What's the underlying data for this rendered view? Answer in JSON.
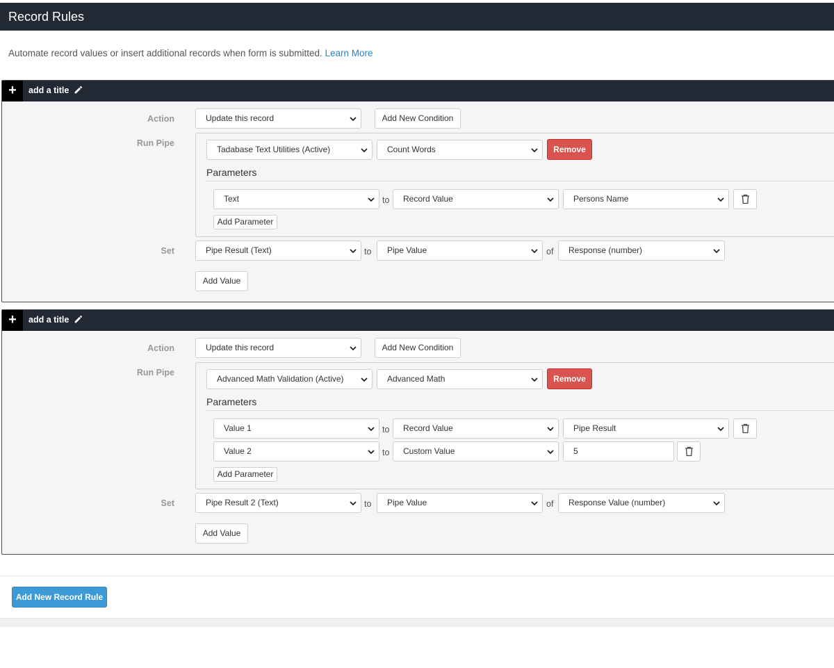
{
  "header": {
    "title": "Record Rules"
  },
  "description": {
    "text": "Automate record values or insert additional records when form is submitted.",
    "link": "Learn More"
  },
  "labels": {
    "action": "Action",
    "run_pipe": "Run Pipe",
    "set": "Set",
    "parameters": "Parameters",
    "to": "to",
    "of": "of"
  },
  "buttons": {
    "add_new_condition": "Add New Condition",
    "remove": "Remove",
    "add_parameter": "Add Parameter",
    "add_value": "Add Value",
    "add_new_record_rule": "Add New Record Rule"
  },
  "rules": [
    {
      "title": "add a title",
      "action": "Update this record",
      "pipe": "Tadabase Text Utilities (Active)",
      "pipe_function": "Count Words",
      "parameters": [
        {
          "name": "Text",
          "source": "Record Value",
          "value": "Persons Name"
        }
      ],
      "set": {
        "field": "Pipe Result (Text)",
        "source": "Pipe Value",
        "target": "Response (number)"
      }
    },
    {
      "title": "add a title",
      "action": "Update this record",
      "pipe": "Advanced Math Validation (Active)",
      "pipe_function": "Advanced Math",
      "parameters": [
        {
          "name": "Value 1",
          "source": "Record Value",
          "value": "Pipe Result"
        },
        {
          "name": "Value 2",
          "source": "Custom Value",
          "value": "5"
        }
      ],
      "set": {
        "field": "Pipe Result 2 (Text)",
        "source": "Pipe Value",
        "target": "Response Value (number)"
      }
    }
  ],
  "colors": {
    "header_bg": "#222834",
    "remove_btn": "#d9534f",
    "primary_btn": "#3c9ad6",
    "link": "#2a86c8"
  }
}
